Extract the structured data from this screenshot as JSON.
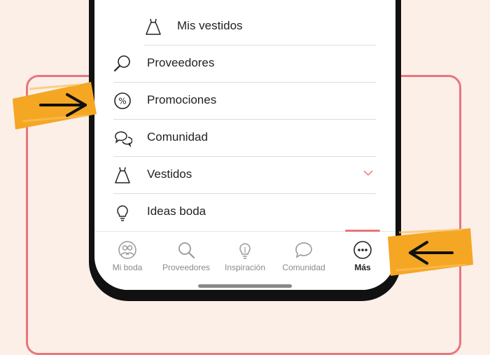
{
  "menu": {
    "items": [
      {
        "label": "Mis vestidos",
        "icon": "dress-icon"
      },
      {
        "label": "Proveedores",
        "icon": "magnifier-icon"
      },
      {
        "label": "Promociones",
        "icon": "percent-icon"
      },
      {
        "label": "Comunidad",
        "icon": "chat-bubbles-icon"
      },
      {
        "label": "Vestidos",
        "icon": "dress-icon"
      },
      {
        "label": "Ideas boda",
        "icon": "lightbulb-icon"
      }
    ]
  },
  "tabbar": {
    "tabs": [
      {
        "label": "Mi boda",
        "icon": "couple-icon"
      },
      {
        "label": "Proveedores",
        "icon": "search-icon"
      },
      {
        "label": "Inspiración",
        "icon": "lightbulb-icon"
      },
      {
        "label": "Comunidad",
        "icon": "chat-icon"
      },
      {
        "label": "Más",
        "icon": "more-icon"
      }
    ],
    "active_index": 4
  },
  "colors": {
    "background": "#fbefe8",
    "accent": "#e8767a",
    "highlight": "#f5a623",
    "text": "#222222",
    "muted": "#8a8a8a"
  }
}
